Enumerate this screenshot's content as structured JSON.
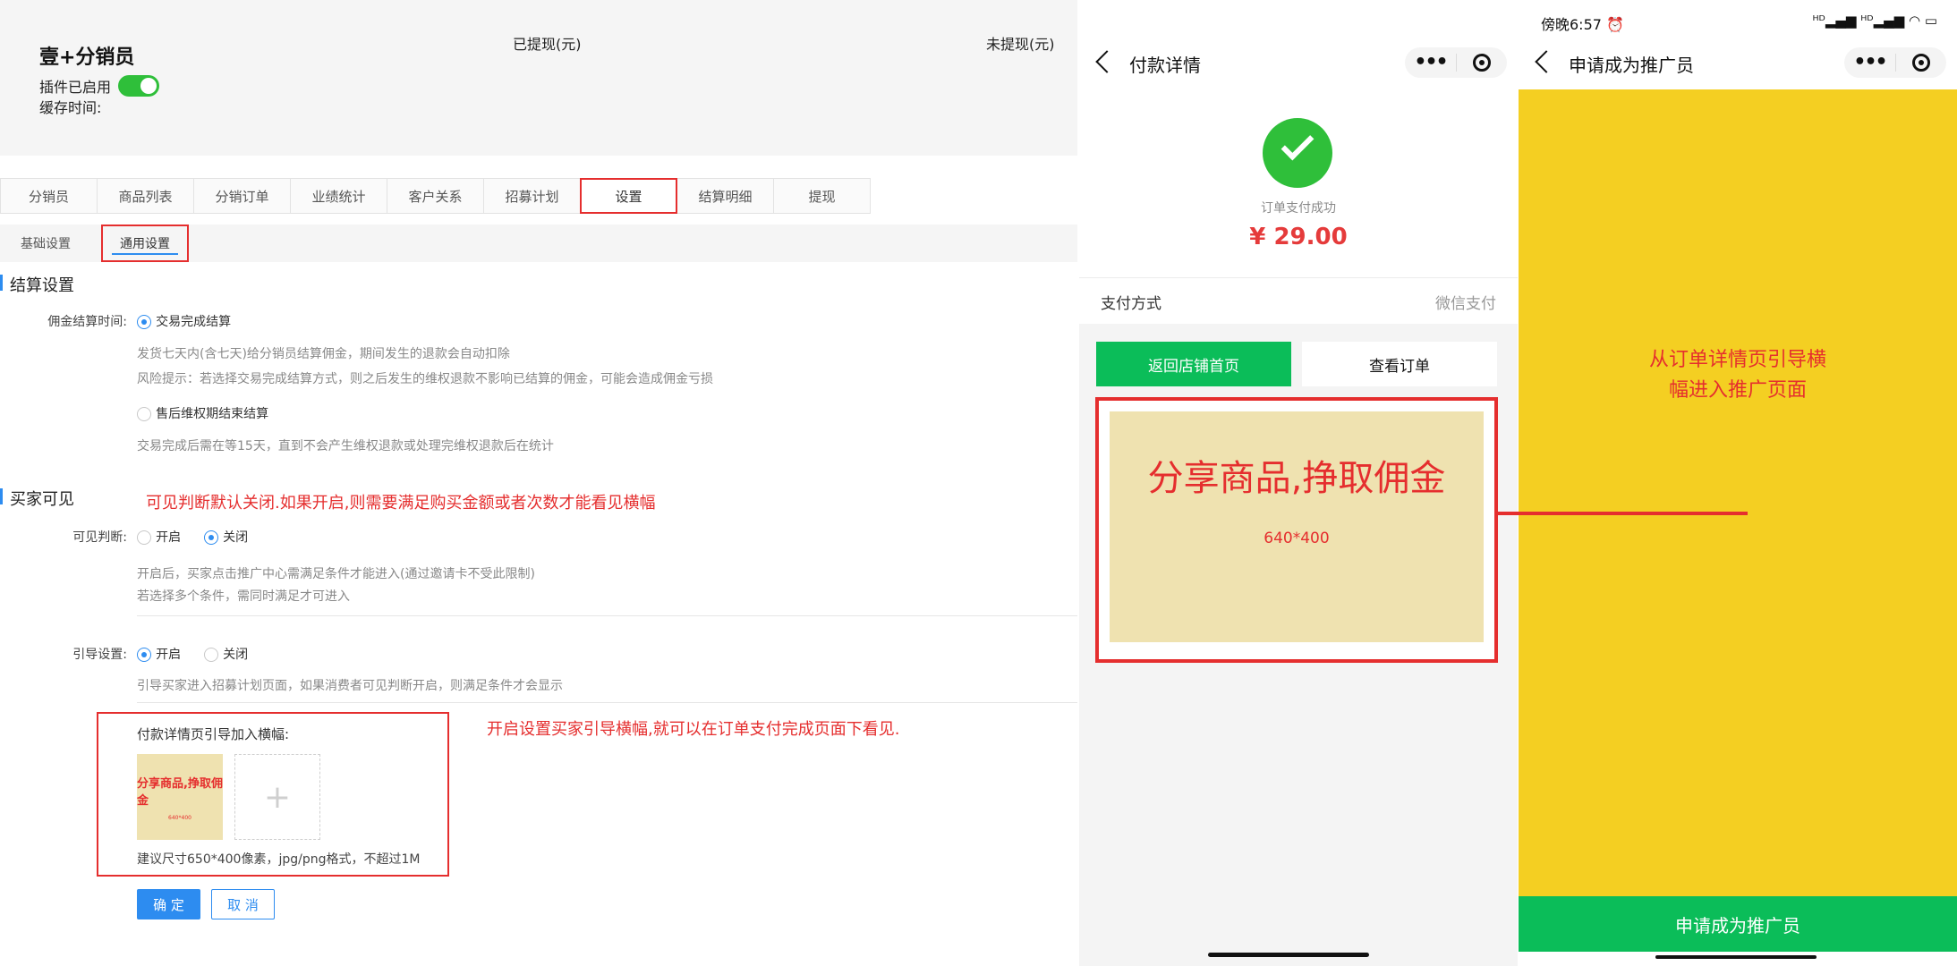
{
  "admin": {
    "plugin_title": "壹+分销员",
    "plugin_status": "插件已启用",
    "cache_label": "缓存时间:",
    "withdrawn_label": "已提现(元)",
    "not_withdrawn_label": "未提现(元)",
    "tabs": [
      {
        "label": "分销员"
      },
      {
        "label": "商品列表"
      },
      {
        "label": "分销订单"
      },
      {
        "label": "业绩统计"
      },
      {
        "label": "客户关系"
      },
      {
        "label": "招募计划"
      },
      {
        "label": "设置",
        "active": true
      },
      {
        "label": "结算明细"
      },
      {
        "label": "提现"
      }
    ],
    "subtabs": [
      {
        "label": "基础设置"
      },
      {
        "label": "通用设置",
        "active": true
      }
    ],
    "settlement": {
      "section_title": "结算设置",
      "commission_time_label": "佣金结算时间:",
      "option1_label": "交易完成结算",
      "option1_hint1": "发货七天内(含七天)给分销员结算佣金，期间发生的退款会自动扣除",
      "option1_hint2": "风险提示：若选择交易完成结算方式，则之后发生的维权退款不影响已结算的佣金，可能会造成佣金亏损",
      "option2_label": "售后维权期结束结算",
      "option2_hint": "交易完成后需在等15天，直到不会产生维权退款或处理完维权退款后在统计"
    },
    "visibility": {
      "section_title": "买家可见",
      "red_note": "可见判断默认关闭.如果开启,则需要满足购买金额或者次数才能看见横幅",
      "visible_label": "可见判断:",
      "on_label": "开启",
      "off_label": "关闭",
      "hint1": "开启后，买家点击推广中心需满足条件才能进入(通过邀请卡不受此限制)",
      "hint2": "若选择多个条件，需同时满足才可进入"
    },
    "guide": {
      "label": "引导设置:",
      "on_label": "开启",
      "off_label": "关闭",
      "hint": "引导买家进入招募计划页面，如果消费者可见判断开启，则满足条件才会显示",
      "red_note": "开启设置买家引导横幅,就可以在订单支付完成页面下看见.",
      "banner_label": "付款详情页引导加入横幅:",
      "thumb_text": "分享商品,挣取佣金",
      "thumb_size": "640*400",
      "upload_icon": "+",
      "size_hint": "建议尺寸650*400像素，jpg/png格式，不超过1M"
    },
    "ok_label": "确 定",
    "cancel_label": "取 消"
  },
  "phone1": {
    "nav_title": "付款详情",
    "pay_success": "订单支付成功",
    "amount": "¥ 29.00",
    "pay_method_label": "支付方式",
    "pay_method_value": "微信支付",
    "home_button": "返回店铺首页",
    "order_button": "查看订单",
    "promo_title": "分享商品,挣取佣金",
    "promo_size": "640*400"
  },
  "phone2": {
    "status_time": "傍晚6:57 ⏰",
    "status_icons": "ᴴᴰ▂▄▆ ᴴᴰ▂▄▆ ◠ ▭",
    "nav_title": "申请成为推广员",
    "annotation_line1": "从订单详情页引导横",
    "annotation_line2": "幅进入推广页面",
    "apply_button": "申请成为推广员"
  },
  "colors": {
    "accent_blue": "#2d8cf0",
    "annotation_red": "#e52e2e",
    "wechat_green": "#0bbd59",
    "banner_yellow": "#f4cf22",
    "banner_beige": "#efe2b0"
  }
}
